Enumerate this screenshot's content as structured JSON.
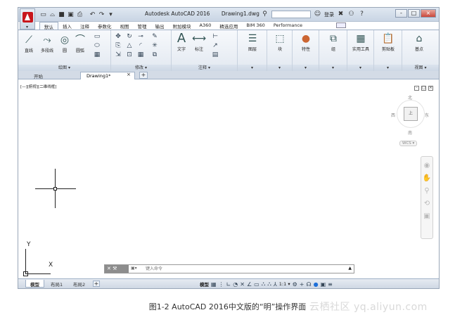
{
  "title_bar": {
    "app_name": "Autodesk AutoCAD 2016",
    "file_name": "Drawing1.dwg",
    "login_label": "登录",
    "window_buttons": [
      "-",
      "□",
      "×"
    ]
  },
  "quick_access": [
    "new-icon",
    "open-icon",
    "save-icon",
    "saveas-icon",
    "print-icon",
    "undo-icon",
    "redo-icon",
    "dropdown-icon"
  ],
  "ribbon_tabs": [
    "默认",
    "插入",
    "注释",
    "参数化",
    "视图",
    "管理",
    "输出",
    "附加模块",
    "A360",
    "精选应用",
    "BIM 360",
    "Performance"
  ],
  "ribbon_active_tab": "默认",
  "panels": {
    "draw": {
      "title": "绘图 ▾",
      "tools": [
        "直线",
        "多段线",
        "圆",
        "圆弧"
      ]
    },
    "modify": {
      "title": "修改 ▾"
    },
    "annotation": {
      "title": "注释 ▾",
      "tools": [
        "文字",
        "标注"
      ]
    },
    "layers": {
      "label": "图层"
    },
    "block": {
      "label": "块"
    },
    "properties": {
      "label": "特性"
    },
    "groups": {
      "label": "组"
    },
    "utilities": {
      "label": "实用工具"
    },
    "clipboard": {
      "label": "剪贴板"
    },
    "view": {
      "label": "基点",
      "title": "视图 ▾"
    }
  },
  "file_tabs": {
    "start": "开始",
    "drawing": "Drawing1*",
    "close": "×",
    "add": "+"
  },
  "viewport_label": "[—][俯视][二维线框]",
  "viewcube": {
    "north": "北",
    "south": "南",
    "west": "西",
    "east": "东",
    "face": "上",
    "wcs": "WCS ▾"
  },
  "ucs": {
    "x": "X",
    "y": "Y"
  },
  "command_line": {
    "buttons": "✕ 🔧",
    "prefix": "▣▾",
    "placeholder": "键入命令"
  },
  "layout_tabs": [
    "模型",
    "布局1",
    "布局2"
  ],
  "status_bar": {
    "model": "模型",
    "scale": "1:1 ▾"
  },
  "caption": "图1-2 AutoCAD 2016中文版的“明”操作界面",
  "watermark": "云栖社区 yq.aliyun.com"
}
